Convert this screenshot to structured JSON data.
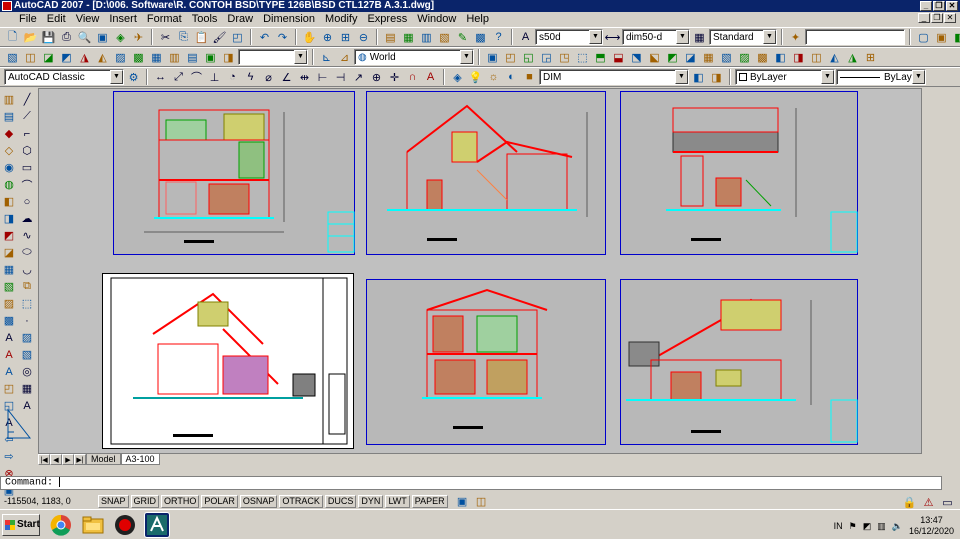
{
  "window": {
    "title": "AutoCAD 2007 - [D:\\006. Software\\R. CONTOH BSD\\TYPE 126B\\BSD CTL127B A.3.1.dwg]"
  },
  "menu": [
    "File",
    "Edit",
    "View",
    "Insert",
    "Format",
    "Tools",
    "Draw",
    "Dimension",
    "Modify",
    "Express",
    "Window",
    "Help"
  ],
  "toolbar": {
    "textstyle": "s50d",
    "dimstyle": "dim50-d",
    "tablestyle": "Standard",
    "ucs": "World",
    "workspace": "AutoCAD Classic",
    "layer": "DIM",
    "color": "ByLayer",
    "linetype": "ByLayer"
  },
  "layout_tabs": [
    "Model",
    "A3-100"
  ],
  "active_tab": "A3-100",
  "command": {
    "prompt": "Command:"
  },
  "status": {
    "coordinates": "-115504, 1183, 0",
    "toggles": [
      "SNAP",
      "GRID",
      "ORTHO",
      "POLAR",
      "OSNAP",
      "OTRACK",
      "DUCS",
      "DYN",
      "LWT",
      "PAPER"
    ]
  },
  "taskbar": {
    "start_label": "Start",
    "language": "IN",
    "time": "13:47",
    "date": "16/12/2020"
  },
  "icons": {
    "start": "windows-flag-icon",
    "chrome": "chrome-icon",
    "explorer": "folder-icon",
    "record": "record-icon",
    "autocad": "autocad-icon"
  },
  "colors": {
    "titlebar": "#0a246a",
    "viewport_border": "#0000cc",
    "cad_red": "#ff0000",
    "cad_green": "#00c000",
    "cad_cyan": "#00ffff"
  }
}
